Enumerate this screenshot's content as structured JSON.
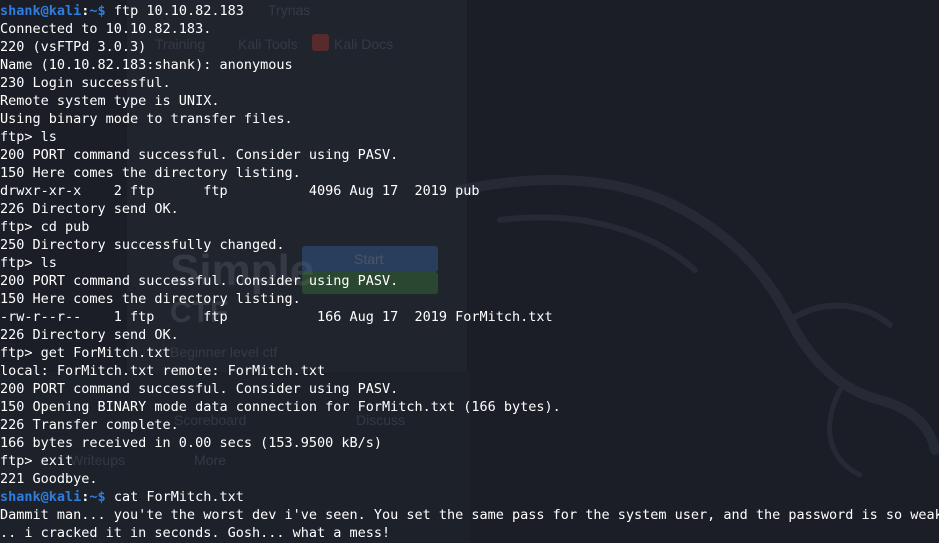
{
  "background": {
    "tab_text": "Trynas",
    "bookmarks": [
      "Training",
      "Kali Tools",
      "Kali Docs"
    ],
    "logo_text": "Simple",
    "logo_sub": "CTF",
    "start_label": "Start",
    "tagline": "Beginner level ctf",
    "menu_items": [
      "Scoreboard",
      "Discuss",
      "Writeups",
      "More"
    ]
  },
  "terminal": {
    "prompt": {
      "user_host": "shank@kali",
      "separator": ":",
      "path": "~$"
    },
    "lines": [
      {
        "type": "prompt",
        "cmd": " ftp 10.10.82.183"
      },
      {
        "type": "out",
        "text": "Connected to 10.10.82.183."
      },
      {
        "type": "out",
        "text": "220 (vsFTPd 3.0.3)"
      },
      {
        "type": "out",
        "text": "Name (10.10.82.183:shank): anonymous"
      },
      {
        "type": "out",
        "text": "230 Login successful."
      },
      {
        "type": "out",
        "text": "Remote system type is UNIX."
      },
      {
        "type": "out",
        "text": "Using binary mode to transfer files."
      },
      {
        "type": "out",
        "text": "ftp> ls"
      },
      {
        "type": "out",
        "text": "200 PORT command successful. Consider using PASV."
      },
      {
        "type": "out",
        "text": "150 Here comes the directory listing."
      },
      {
        "type": "out",
        "text": "drwxr-xr-x    2 ftp      ftp          4096 Aug 17  2019 pub"
      },
      {
        "type": "out",
        "text": "226 Directory send OK."
      },
      {
        "type": "out",
        "text": "ftp> cd pub"
      },
      {
        "type": "out",
        "text": "250 Directory successfully changed."
      },
      {
        "type": "out",
        "text": "ftp> ls"
      },
      {
        "type": "out",
        "text": "200 PORT command successful. Consider using PASV."
      },
      {
        "type": "out",
        "text": "150 Here comes the directory listing."
      },
      {
        "type": "out",
        "text": "-rw-r--r--    1 ftp      ftp           166 Aug 17  2019 ForMitch.txt"
      },
      {
        "type": "out",
        "text": "226 Directory send OK."
      },
      {
        "type": "out",
        "text": "ftp> get ForMitch.txt"
      },
      {
        "type": "out",
        "text": "local: ForMitch.txt remote: ForMitch.txt"
      },
      {
        "type": "out",
        "text": "200 PORT command successful. Consider using PASV."
      },
      {
        "type": "out",
        "text": "150 Opening BINARY mode data connection for ForMitch.txt (166 bytes)."
      },
      {
        "type": "out",
        "text": "226 Transfer complete."
      },
      {
        "type": "out",
        "text": "166 bytes received in 0.00 secs (153.9500 kB/s)"
      },
      {
        "type": "out",
        "text": "ftp> exit"
      },
      {
        "type": "out",
        "text": "221 Goodbye."
      },
      {
        "type": "prompt",
        "cmd": " cat ForMitch.txt"
      },
      {
        "type": "out",
        "text": "Dammit man... you'te the worst dev i've seen. You set the same pass for the system user, and the password is so weak."
      },
      {
        "type": "out",
        "text": ".. i cracked it in seconds. Gosh... what a mess!"
      }
    ]
  },
  "colors": {
    "terminal_bg": "#1b1e26",
    "prompt_blue": "#2f7dde",
    "text": "#ffffff"
  }
}
